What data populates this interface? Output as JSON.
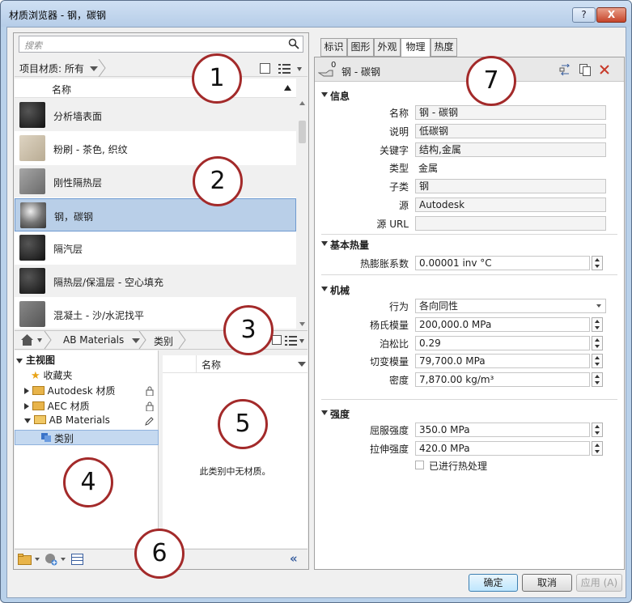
{
  "window": {
    "title": "材质浏览器 - 钢，碳钢",
    "help_label": "?",
    "close_label": "X"
  },
  "search": {
    "placeholder": "搜索"
  },
  "filter": {
    "label": "项目材质: 所有"
  },
  "list": {
    "column_header": "名称",
    "items": [
      {
        "label": "分析墙表面",
        "thumb": "#1e1e1e"
      },
      {
        "label": "粉刷 - 茶色, 织纹",
        "thumb": "#cbbfa9"
      },
      {
        "label": "刚性隔热层",
        "thumb": "#8a8a8a"
      },
      {
        "label": "钢，碳钢",
        "thumb": "#6e6e6e"
      },
      {
        "label": "隔汽层",
        "thumb": "#1e1e1e"
      },
      {
        "label": "隔热层/保温层 - 空心填充",
        "thumb": "#1e1e1e"
      },
      {
        "label": "混凝土 - 沙/水泥找平",
        "thumb": "#6f6f6f"
      }
    ]
  },
  "library_bar": {
    "library": "AB Materials",
    "category": "类别"
  },
  "tree": {
    "root": "主视图",
    "favorites": "收藏夹",
    "items": [
      "Autodesk 材质",
      "AEC 材质",
      "AB Materials"
    ],
    "sub": "类别"
  },
  "materials_pane": {
    "column_header": "名称",
    "empty_text": "此类别中无材质。"
  },
  "tabs": [
    "标识",
    "图形",
    "外观",
    "物理",
    "热度"
  ],
  "asset": {
    "count": "0",
    "name": "钢 - 碳钢"
  },
  "info": {
    "section": "信息",
    "name_label": "名称",
    "name_value": "钢 - 碳钢",
    "desc_label": "说明",
    "desc_value": "低碳钢",
    "kw_label": "关键字",
    "kw_value": "结构,金属",
    "type_label": "类型",
    "type_value": "金属",
    "subtype_label": "子类",
    "subtype_value": "钢",
    "source_label": "源",
    "source_value": "Autodesk",
    "url_label": "源 URL",
    "url_value": ""
  },
  "thermal": {
    "section": "基本热量",
    "exp_label": "热膨胀系数",
    "exp_value": "0.00001 inv °C"
  },
  "mechanical": {
    "section": "机械",
    "behavior_label": "行为",
    "behavior_value": "各向同性",
    "young_label": "杨氏模量",
    "young_value": "200,000.0 MPa",
    "poisson_label": "泊松比",
    "poisson_value": "0.29",
    "shear_label": "切变模量",
    "shear_value": "79,700.0 MPa",
    "density_label": "密度",
    "density_value": "7,870.00 kg/m³"
  },
  "strength": {
    "section": "强度",
    "yield_label": "屈服强度",
    "yield_value": "350.0 MPa",
    "tensile_label": "拉伸强度",
    "tensile_value": "420.0 MPa",
    "heat_label": "已进行热处理"
  },
  "buttons": {
    "ok": "确定",
    "cancel": "取消",
    "apply": "应用 (A)"
  },
  "callouts": [
    "1",
    "2",
    "3",
    "4",
    "5",
    "6",
    "7"
  ],
  "colors": {
    "accent": "#a32a2a",
    "selection": "#b9cfe8"
  }
}
